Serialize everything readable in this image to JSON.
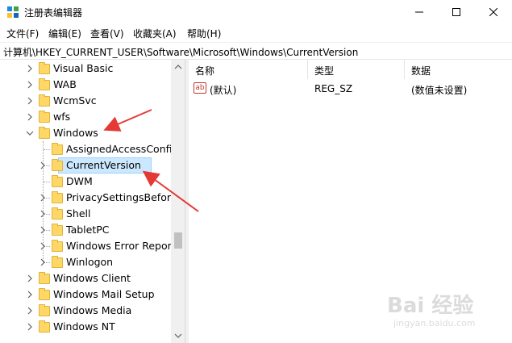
{
  "window": {
    "title": "注册表编辑器"
  },
  "menu": [
    "文件(F)",
    "编辑(E)",
    "查看(V)",
    "收藏夹(A)",
    "帮助(H)"
  ],
  "address": "计算机\\HKEY_CURRENT_USER\\Software\\Microsoft\\Windows\\CurrentVersion",
  "tree": {
    "items": [
      {
        "label": "Visual Basic",
        "level": 1,
        "expandable": true
      },
      {
        "label": "WAB",
        "level": 1,
        "expandable": true
      },
      {
        "label": "WcmSvc",
        "level": 1,
        "expandable": true
      },
      {
        "label": "wfs",
        "level": 1,
        "expandable": true
      },
      {
        "label": "Windows",
        "level": 1,
        "expandable": true,
        "expanded": true
      },
      {
        "label": "AssignedAccessConfig",
        "level": 2,
        "expandable": false
      },
      {
        "label": "CurrentVersion",
        "level": 2,
        "expandable": true,
        "selected": true
      },
      {
        "label": "DWM",
        "level": 2,
        "expandable": false
      },
      {
        "label": "PrivacySettingsBeforeC",
        "level": 2,
        "expandable": true
      },
      {
        "label": "Shell",
        "level": 2,
        "expandable": true
      },
      {
        "label": "TabletPC",
        "level": 2,
        "expandable": true
      },
      {
        "label": "Windows Error Report",
        "level": 2,
        "expandable": true
      },
      {
        "label": "Winlogon",
        "level": 2,
        "expandable": true
      },
      {
        "label": "Windows Client",
        "level": 1,
        "expandable": true
      },
      {
        "label": "Windows Mail Setup",
        "level": 1,
        "expandable": true
      },
      {
        "label": "Windows Media",
        "level": 1,
        "expandable": true
      },
      {
        "label": "Windows NT",
        "level": 1,
        "expandable": true
      }
    ]
  },
  "list": {
    "columns": [
      "名称",
      "类型",
      "数据"
    ],
    "rows": [
      {
        "name": "(默认)",
        "type": "REG_SZ",
        "data": "(数值未设置)",
        "icon": "ab-icon"
      }
    ]
  },
  "watermark": {
    "main": "Bai 经验",
    "sub": "jingyan.baidu.com"
  },
  "colors": {
    "selection": "#cce8ff",
    "folder": "#ffd766",
    "annotation_arrow": "#e53935"
  }
}
